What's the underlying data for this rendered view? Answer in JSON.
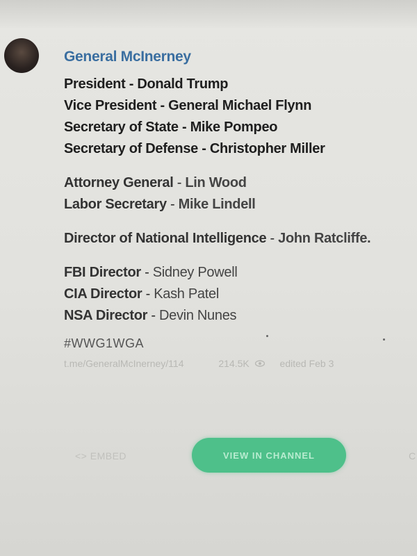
{
  "post": {
    "author": "General McInerney",
    "lines_block1": [
      {
        "role": "President",
        "name": "Donald Trump"
      },
      {
        "role": "Vice President",
        "name": "General Michael Flynn"
      },
      {
        "role": "Secretary of State",
        "name": "Mike Pompeo"
      },
      {
        "role": "Secretary of Defense",
        "name": "Christopher Miller"
      }
    ],
    "lines_block2": [
      {
        "role": "Attorney General",
        "name": "Lin Wood"
      },
      {
        "role": "Labor Secretary",
        "name": "Mike Lindell"
      }
    ],
    "lines_block3": [
      {
        "role": "Director of National Intelligence",
        "name": "John Ratcliffe."
      }
    ],
    "lines_block4": [
      {
        "role": "FBI Director",
        "name": "Sidney Powell"
      },
      {
        "role": "CIA Director",
        "name": "Kash Patel"
      },
      {
        "role": "NSA Director",
        "name": "Devin Nunes"
      }
    ],
    "separator": " - ",
    "hashtag": "#WWG1WGA",
    "link": "t.me/GeneralMcInerney/114",
    "views": "214.5K",
    "edited": "edited Feb 3"
  },
  "actions": {
    "embed_label": "<> EMBED",
    "view_channel_label": "VIEW IN CHANNEL",
    "corner_label": "C"
  },
  "icons": {
    "views": "eye-icon"
  },
  "colors": {
    "author": "#3a6ea0",
    "button": "#4ec08a"
  }
}
